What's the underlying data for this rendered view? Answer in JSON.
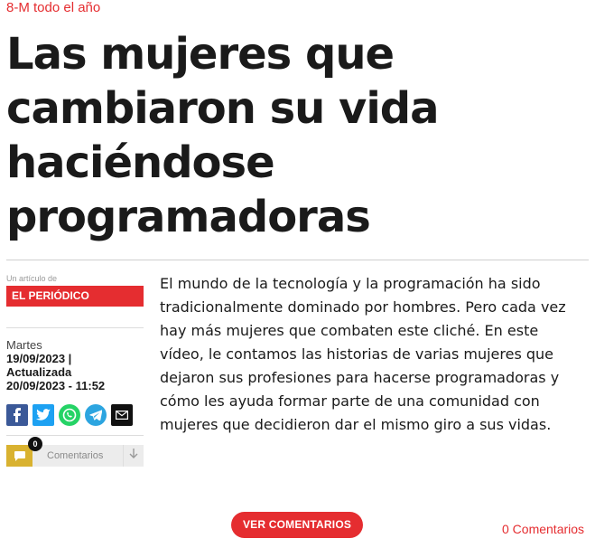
{
  "article": {
    "kicker": "8-M todo el año",
    "title": "Las mujeres que cambiaron su vida haciéndose programadoras",
    "body": "El mundo de la tecnología y la programación ha sido tradicionalmente dominado por hombres. Pero cada vez hay más mujeres que combaten este cliché. En este vídeo, le contamos las historias de varias mujeres que dejaron sus profesiones para hacerse programadoras y cómo les ayuda formar parte de una comunidad con mujeres que decidieron dar el mismo giro a sus vidas."
  },
  "meta": {
    "by_label": "Un artículo de",
    "publisher": "EL PERIÓDICO",
    "day": "Martes",
    "published": "19/09/2023 |",
    "updated_label": "Actualizada",
    "updated": "20/09/2023 - 11:52"
  },
  "share": [
    {
      "name": "facebook-icon",
      "glyph": "f"
    },
    {
      "name": "twitter-icon",
      "glyph": "t"
    },
    {
      "name": "whatsapp-icon",
      "glyph": "✆"
    },
    {
      "name": "telegram-icon",
      "glyph": "➤"
    },
    {
      "name": "email-icon",
      "glyph": "✉"
    }
  ],
  "comments": {
    "count_badge": "0",
    "label": "Comentarios",
    "button": "VER COMENTARIOS",
    "count_link": "0 Comentarios"
  },
  "colors": {
    "accent": "#e52d30",
    "comment_icon": "#d9b230"
  }
}
